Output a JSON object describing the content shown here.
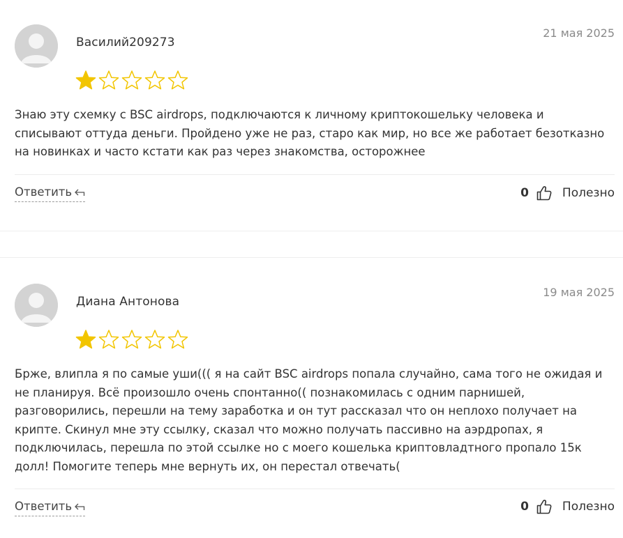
{
  "reviews": [
    {
      "author": "Василий209273",
      "date": "21 мая 2025",
      "rating": 1,
      "max_rating": 5,
      "text": "Знаю эту схемку с BSC airdrops, подключаются к личному криптокошельку человека и списывают оттуда деньги. Пройдено уже не раз, старо как мир, но все же работает безотказно на новинках и часто кстати как раз через знакомства, осторожнее",
      "reply_label": "Ответить",
      "useful_count": "0",
      "useful_label": "Полезно"
    },
    {
      "author": "Диана Антонова",
      "date": "19 мая 2025",
      "rating": 1,
      "max_rating": 5,
      "text": "Бржe, влипла я по самые уши((( я на сайт BSC airdrops попала случайно, сама того не ожидая и не планируя. Всё произошло очень спонтанно(( познакомилась с одним парнишей, разговорились, перешли на тему заработка и он тут рассказал что он неплохо получает на крипте. Скинул мне эту ссылку, сказал что можно получать пассивно на аэрдропах, я подключилась, перешла по этой ссылке но с моего кошелька криптовладтного пропало 15к долл! Помогите теперь мне вернуть их, он перестал отвечать(",
      "reply_label": "Ответить",
      "useful_count": "0",
      "useful_label": "Полезно"
    }
  ],
  "icons": {
    "avatar": "user-placeholder-icon",
    "star_filled": "star-filled-icon",
    "star_empty": "star-empty-icon",
    "reply": "reply-arrow-icon",
    "thumb": "thumbs-up-icon"
  },
  "colors": {
    "star": "#f2c500",
    "divider": "#ececec",
    "muted": "#8a8a8a"
  }
}
